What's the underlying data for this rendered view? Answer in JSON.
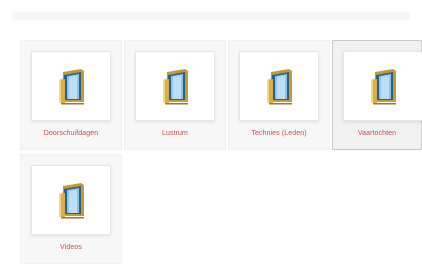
{
  "header": {
    "title": ""
  },
  "folders": [
    {
      "label": "Doorschuifdagen",
      "icon": "folder-icon",
      "selected": false
    },
    {
      "label": "Lustrum",
      "icon": "folder-icon",
      "selected": false
    },
    {
      "label": "Technies (Leden)",
      "icon": "folder-icon",
      "selected": false
    },
    {
      "label": "Vaartochten",
      "icon": "folder-icon",
      "selected": true
    },
    {
      "label": "Videos",
      "icon": "folder-icon",
      "selected": false
    }
  ],
  "colors": {
    "label": "#c94b4b",
    "folder_front": "#d7b04a",
    "folder_back": "#c39a36",
    "folder_doc_blue": "#8fc3e6",
    "folder_doc_dark": "#2e5f86"
  }
}
